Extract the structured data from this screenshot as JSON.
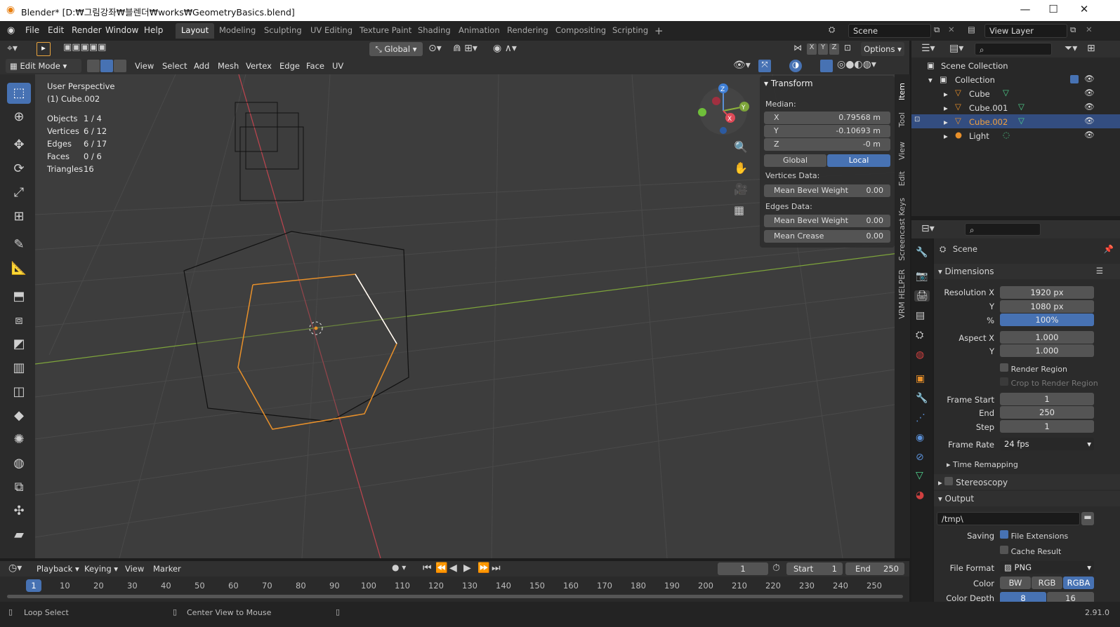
{
  "window": {
    "title": "Blender* [D:₩그림강좌₩블렌더₩works₩GeometryBasics.blend]"
  },
  "menu": [
    "File",
    "Edit",
    "Render",
    "Window",
    "Help"
  ],
  "workspaces": [
    "Layout",
    "Modeling",
    "Sculpting",
    "UV Editing",
    "Texture Paint",
    "Shading",
    "Animation",
    "Rendering",
    "Compositing",
    "Scripting"
  ],
  "top": {
    "scene": "Scene",
    "view_layer": "View Layer"
  },
  "vp_header": {
    "mode": "Edit Mode",
    "menus": [
      "View",
      "Select",
      "Add",
      "Mesh",
      "Vertex",
      "Edge",
      "Face",
      "UV"
    ],
    "orientation": "Global",
    "options": "Options",
    "axes": [
      "X",
      "Y",
      "Z"
    ]
  },
  "overlay": {
    "perspective": "User Perspective",
    "object": "(1) Cube.002",
    "stats": [
      {
        "label": "Objects",
        "value": "1 / 4"
      },
      {
        "label": "Vertices",
        "value": "6 / 12"
      },
      {
        "label": "Edges",
        "value": "6 / 17"
      },
      {
        "label": "Faces",
        "value": "0 / 6"
      },
      {
        "label": "Triangles",
        "value": "16"
      }
    ]
  },
  "transform": {
    "title": "Transform",
    "median": "Median:",
    "x_label": "X",
    "x": "0.79568 m",
    "y_label": "Y",
    "y": "-0.10693 m",
    "z_label": "Z",
    "z": "-0 m",
    "global": "Global",
    "local": "Local",
    "vertices_data": "Vertices Data:",
    "mean_bevel_weight": "Mean Bevel Weight",
    "vbw": "0.00",
    "edges_data": "Edges Data:",
    "ebw": "0.00",
    "mean_crease": "Mean Crease",
    "crease": "0.00"
  },
  "side_tabs": [
    "Item",
    "Tool",
    "View",
    "Edit",
    "Screencast Keys",
    "VRM HELPER"
  ],
  "outliner": {
    "root": "Scene Collection",
    "collection": "Collection",
    "items": [
      "Cube",
      "Cube.001",
      "Cube.002",
      "Light"
    ]
  },
  "properties": {
    "scene": "Scene",
    "dimensions": "Dimensions",
    "res_x_label": "Resolution X",
    "res_x": "1920 px",
    "res_y_label": "Y",
    "res_y": "1080 px",
    "pct_label": "%",
    "pct": "100%",
    "aspect_x_label": "Aspect X",
    "aspect_x": "1.000",
    "aspect_y_label": "Y",
    "aspect_y": "1.000",
    "render_region": "Render Region",
    "crop": "Crop to Render Region",
    "frame_start_label": "Frame Start",
    "frame_start": "1",
    "end_label": "End",
    "end": "250",
    "step_label": "Step",
    "step": "1",
    "frame_rate_label": "Frame Rate",
    "frame_rate": "24 fps",
    "time_remapping": "Time Remapping",
    "stereoscopy": "Stereoscopy",
    "output": "Output",
    "path": "/tmp\\",
    "saving": "Saving",
    "file_ext": "File Extensions",
    "cache": "Cache Result",
    "file_format_label": "File Format",
    "file_format": "PNG",
    "color_label": "Color",
    "color_opts": [
      "BW",
      "RGB",
      "RGBA"
    ],
    "color_depth_label": "Color Depth",
    "depth_opts": [
      "8",
      "16"
    ]
  },
  "timeline": {
    "menus": [
      "Playback",
      "Keying",
      "View",
      "Marker"
    ],
    "current": "1",
    "start_label": "Start",
    "start": "1",
    "end_label": "End",
    "end": "250",
    "ticks": [
      "1",
      "10",
      "20",
      "30",
      "40",
      "50",
      "60",
      "70",
      "80",
      "90",
      "100",
      "110",
      "120",
      "130",
      "140",
      "150",
      "160",
      "170",
      "180",
      "190",
      "200",
      "210",
      "220",
      "230",
      "240",
      "250"
    ]
  },
  "status": {
    "left": "Loop Select",
    "middle": "Center View to Mouse",
    "version": "2.91.0"
  }
}
